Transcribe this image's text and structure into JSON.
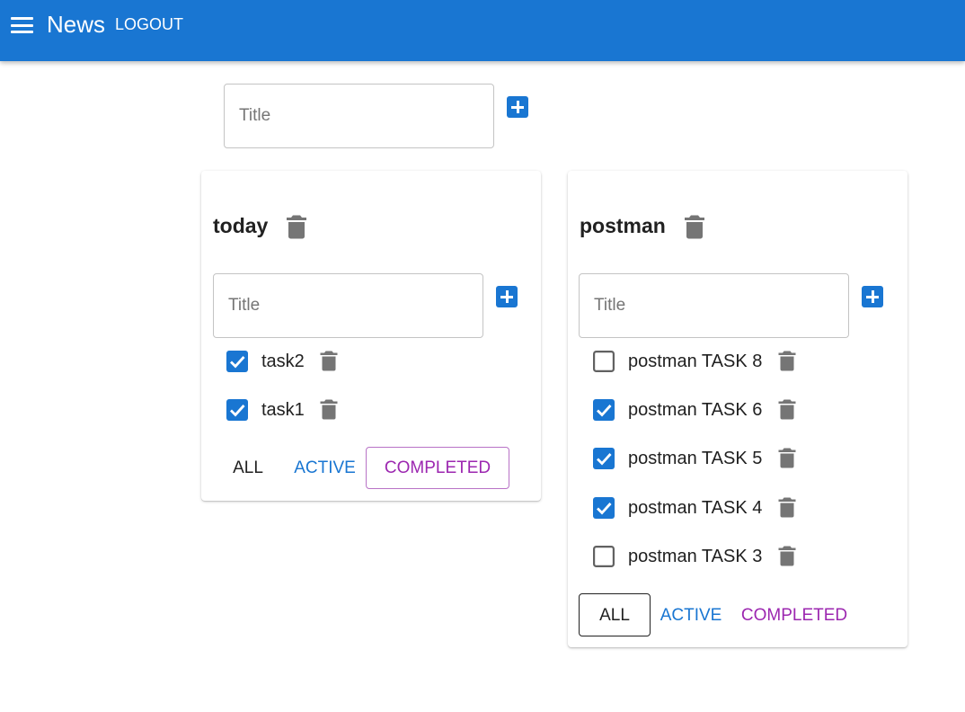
{
  "appbar": {
    "menu_icon": "menu-icon",
    "title": "News",
    "logout_label": "LOGOUT"
  },
  "new_list": {
    "placeholder": "Title",
    "add_icon": "add-box-icon"
  },
  "lists": [
    {
      "title": "today",
      "input_placeholder": "Title",
      "tasks": [
        {
          "label": "task2",
          "checked": true
        },
        {
          "label": "task1",
          "checked": true
        }
      ],
      "filters": {
        "all": "ALL",
        "active": "ACTIVE",
        "completed": "COMPLETED"
      },
      "selected_filter": "completed"
    },
    {
      "title": "postman",
      "input_placeholder": "Title",
      "tasks": [
        {
          "label": "postman TASK 8",
          "checked": false
        },
        {
          "label": "postman TASK 6",
          "checked": true
        },
        {
          "label": "postman TASK 5",
          "checked": true
        },
        {
          "label": "postman TASK 4",
          "checked": true
        },
        {
          "label": "postman TASK 3",
          "checked": false
        }
      ],
      "filters": {
        "all": "ALL",
        "active": "ACTIVE",
        "completed": "COMPLETED"
      },
      "selected_filter": "all"
    }
  ],
  "icons": {
    "delete": "trash-icon",
    "checkbox_checked": "checkbox-checked-icon",
    "checkbox_unchecked": "checkbox-unchecked-icon"
  },
  "colors": {
    "primary": "#1976d2",
    "secondary": "#9c27b0",
    "icon_grey": "#757575",
    "text": "#212121"
  }
}
